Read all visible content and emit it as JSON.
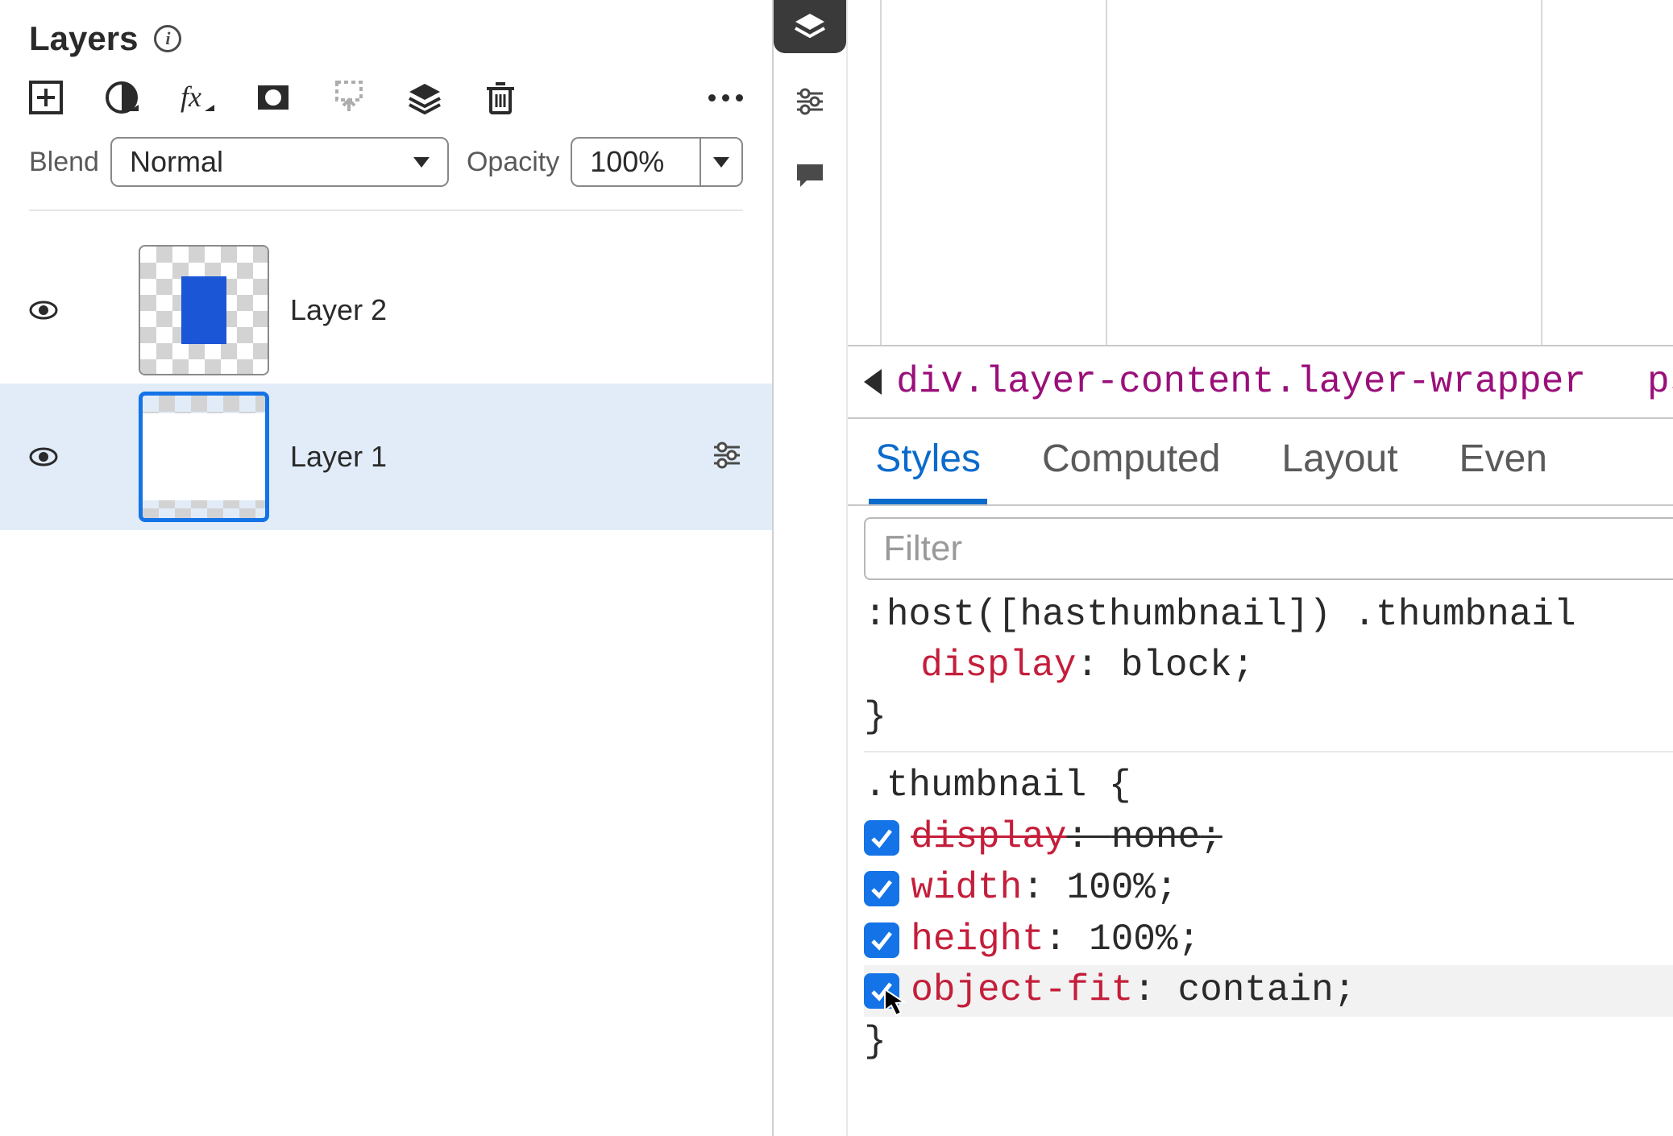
{
  "panel": {
    "title": "Layers",
    "blend_label": "Blend",
    "blend_value": "Normal",
    "opacity_label": "Opacity",
    "opacity_value": "100%"
  },
  "layers": [
    {
      "name": "Layer 2",
      "selected": false
    },
    {
      "name": "Layer 1",
      "selected": true
    }
  ],
  "devtools": {
    "breadcrumb": [
      "div.layer-content.layer-wrapper",
      "psw"
    ],
    "tabs": [
      "Styles",
      "Computed",
      "Layout",
      "Even"
    ],
    "active_tab": "Styles",
    "filter_placeholder": "Filter",
    "rules": [
      {
        "selector": ":host([hasthumbnail]) .thumbnail",
        "open_brace_visible": false,
        "props": [
          {
            "checkbox": false,
            "name": "display",
            "value": "block",
            "struck": false
          }
        ]
      },
      {
        "selector": ".thumbnail {",
        "open_brace_visible": true,
        "props": [
          {
            "checkbox": true,
            "name": "display",
            "value": "none",
            "struck": true
          },
          {
            "checkbox": true,
            "name": "width",
            "value": "100%",
            "struck": false
          },
          {
            "checkbox": true,
            "name": "height",
            "value": "100%",
            "struck": false
          },
          {
            "checkbox": true,
            "name": "object-fit",
            "value": "contain",
            "struck": false,
            "highlighted": true
          }
        ]
      }
    ]
  }
}
